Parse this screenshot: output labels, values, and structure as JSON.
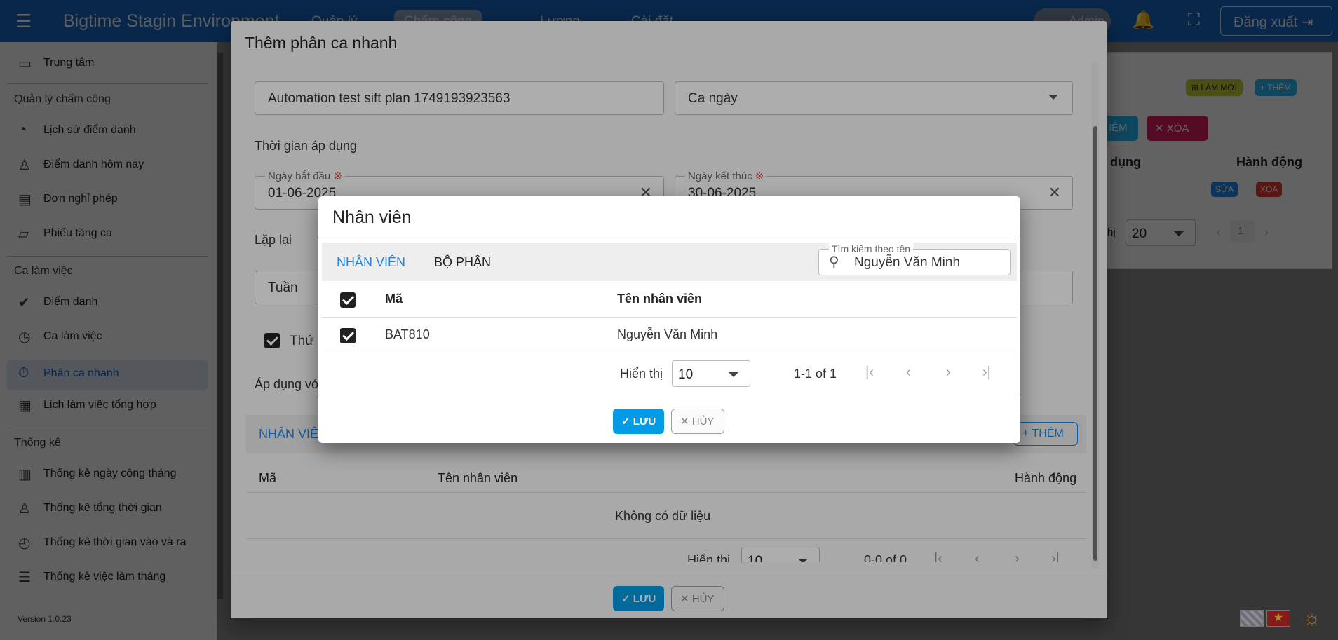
{
  "appbar": {
    "title": "Bigtime Stagin Environment",
    "nav": [
      "Quản lý",
      "Chấm công",
      "Lương",
      "Cài đặt"
    ],
    "admin": "Admin",
    "logout": "Đăng xuất"
  },
  "sidebar": {
    "top_item": "Trung tâm",
    "sections": [
      {
        "head": "Quản lý chấm công",
        "items": [
          "Lịch sử điểm danh",
          "Điểm danh hôm nay",
          "Đơn nghỉ phép",
          "Phiếu tăng ca"
        ]
      },
      {
        "head": "Ca làm việc",
        "items": [
          "Điểm danh",
          "Ca làm việc",
          "Phân ca nhanh",
          "Lịch làm việc tổng hợp"
        ]
      },
      {
        "head": "Thống kê",
        "items": [
          "Thống kê ngày công tháng",
          "Thống kê tổng thời gian",
          "Thống kê thời gian vào và ra",
          "Thống kê việc làm tháng"
        ]
      }
    ],
    "version": "Version 1.0.23"
  },
  "background": {
    "refresh": "LÀM MỚI",
    "add": "THÊM",
    "add_partial": "IÊM",
    "delete": "XÓA",
    "col_apply": "dụng",
    "col_action": "Hành động",
    "edit": "SỬA",
    "del_small": "XÓA",
    "show": "hị",
    "per_page": "20",
    "page": "1"
  },
  "dialog1": {
    "title": "Thêm phân ca nhanh",
    "name_value": "Automation test sift plan 1749193923563",
    "shift_value": "Ca ngày",
    "time_label": "Thời gian áp dụng",
    "start_label": "Ngày bắt đầu",
    "start_value": "01-06-2025",
    "end_label": "Ngày kết thúc",
    "end_value": "30-06-2025",
    "repeat_label": "Lặp lại",
    "repeat_value": "Tuần",
    "weekday_label": "Thứ",
    "apply_label": "Áp dụng vớ",
    "tab_label": "NHÂN VIÊ",
    "add_label": "THÊM",
    "col_code": "Mã",
    "col_name": "Tên nhân viên",
    "col_action": "Hành động",
    "empty": "Không có dữ liệu",
    "show_label": "Hiển thị",
    "per_page": "10",
    "range": "0-0 of 0",
    "save": "LƯU",
    "cancel": "HỦY"
  },
  "dialog2": {
    "title": "Nhân viên",
    "tabs": [
      "NHÂN VIÊN",
      "BỘ PHẬN"
    ],
    "search_label": "Tìm kiếm theo tên",
    "search_value": "Nguyễn Văn Minh",
    "col_code": "Mã",
    "col_name": "Tên nhân viên",
    "rows": [
      {
        "code": "BAT810",
        "name": "Nguyễn Văn Minh",
        "checked": true
      }
    ],
    "show_label": "Hiển thị",
    "per_page": "10",
    "range": "1-1 of 1",
    "save": "LƯU",
    "cancel": "HỦY"
  },
  "colors": {
    "primary": "#1565c0",
    "accent": "#039be5",
    "danger": "#d81b60"
  }
}
